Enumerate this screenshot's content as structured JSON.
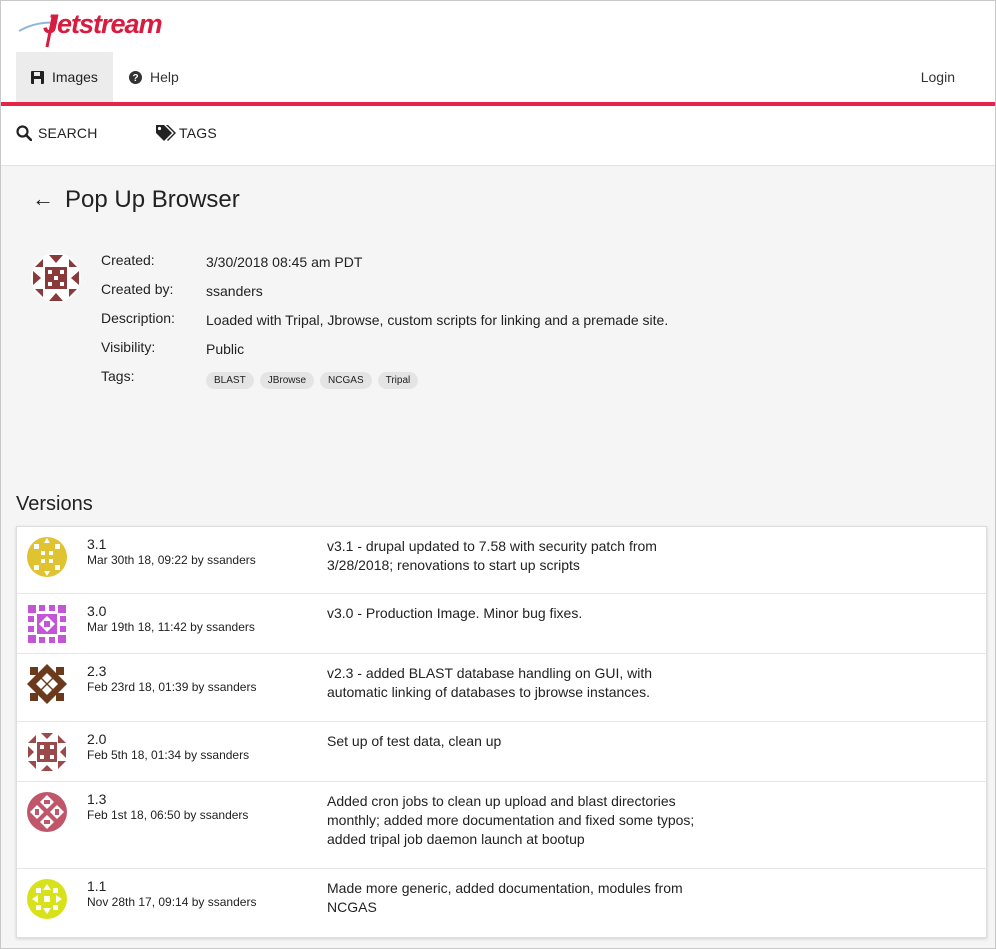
{
  "app": {
    "logo_text": "Jetstream"
  },
  "nav": {
    "images_label": "Images",
    "help_label": "Help",
    "login_label": "Login"
  },
  "subnav": {
    "search_label": "SEARCH",
    "tags_label": "TAGS"
  },
  "image": {
    "title": "Pop Up Browser",
    "details": {
      "created_label": "Created:",
      "created_value": "3/30/2018 08:45 am PDT",
      "created_by_label": "Created by:",
      "created_by_value": "ssanders",
      "description_label": "Description:",
      "description_value": "Loaded with Tripal, Jbrowse, custom scripts for linking and a premade site.",
      "visibility_label": "Visibility:",
      "visibility_value": "Public",
      "tags_label": "Tags:"
    },
    "tags": [
      "BLAST",
      "JBrowse",
      "NCGAS",
      "Tripal"
    ]
  },
  "versions": {
    "heading": "Versions",
    "items": [
      {
        "number": "3.1",
        "meta": "Mar 30th 18, 09:22 by ssanders",
        "description": "v3.1 - drupal updated to 7.58 with security patch from 3/28/2018; renovations to start up scripts",
        "color": "#e0c331"
      },
      {
        "number": "3.0",
        "meta": "Mar 19th 18, 11:42 by ssanders",
        "description": "v3.0 - Production Image. Minor bug fixes.",
        "color": "#c455d6"
      },
      {
        "number": "2.3",
        "meta": "Feb 23rd 18, 01:39 by ssanders",
        "description": "v2.3 - added BLAST database handling on GUI, with automatic linking of databases to jbrowse instances.",
        "color": "#6b3a1c"
      },
      {
        "number": "2.0",
        "meta": "Feb 5th 18, 01:34 by ssanders",
        "description": "Set up of test data, clean up",
        "color": "#9a4a4a"
      },
      {
        "number": "1.3",
        "meta": "Feb 1st 18, 06:50 by ssanders",
        "description": "Added cron jobs to clean up upload and blast directories monthly; added more documentation and fixed some typos; added tripal job daemon launch at bootup",
        "color": "#c0566a"
      },
      {
        "number": "1.1",
        "meta": "Nov 28th 17, 09:14 by ssanders",
        "description": "Made more generic, added documentation, modules from NCGAS",
        "color": "#d8e21a"
      }
    ]
  },
  "colors": {
    "accent": "#e8234a",
    "main_avatar": "#8a3a3a"
  }
}
